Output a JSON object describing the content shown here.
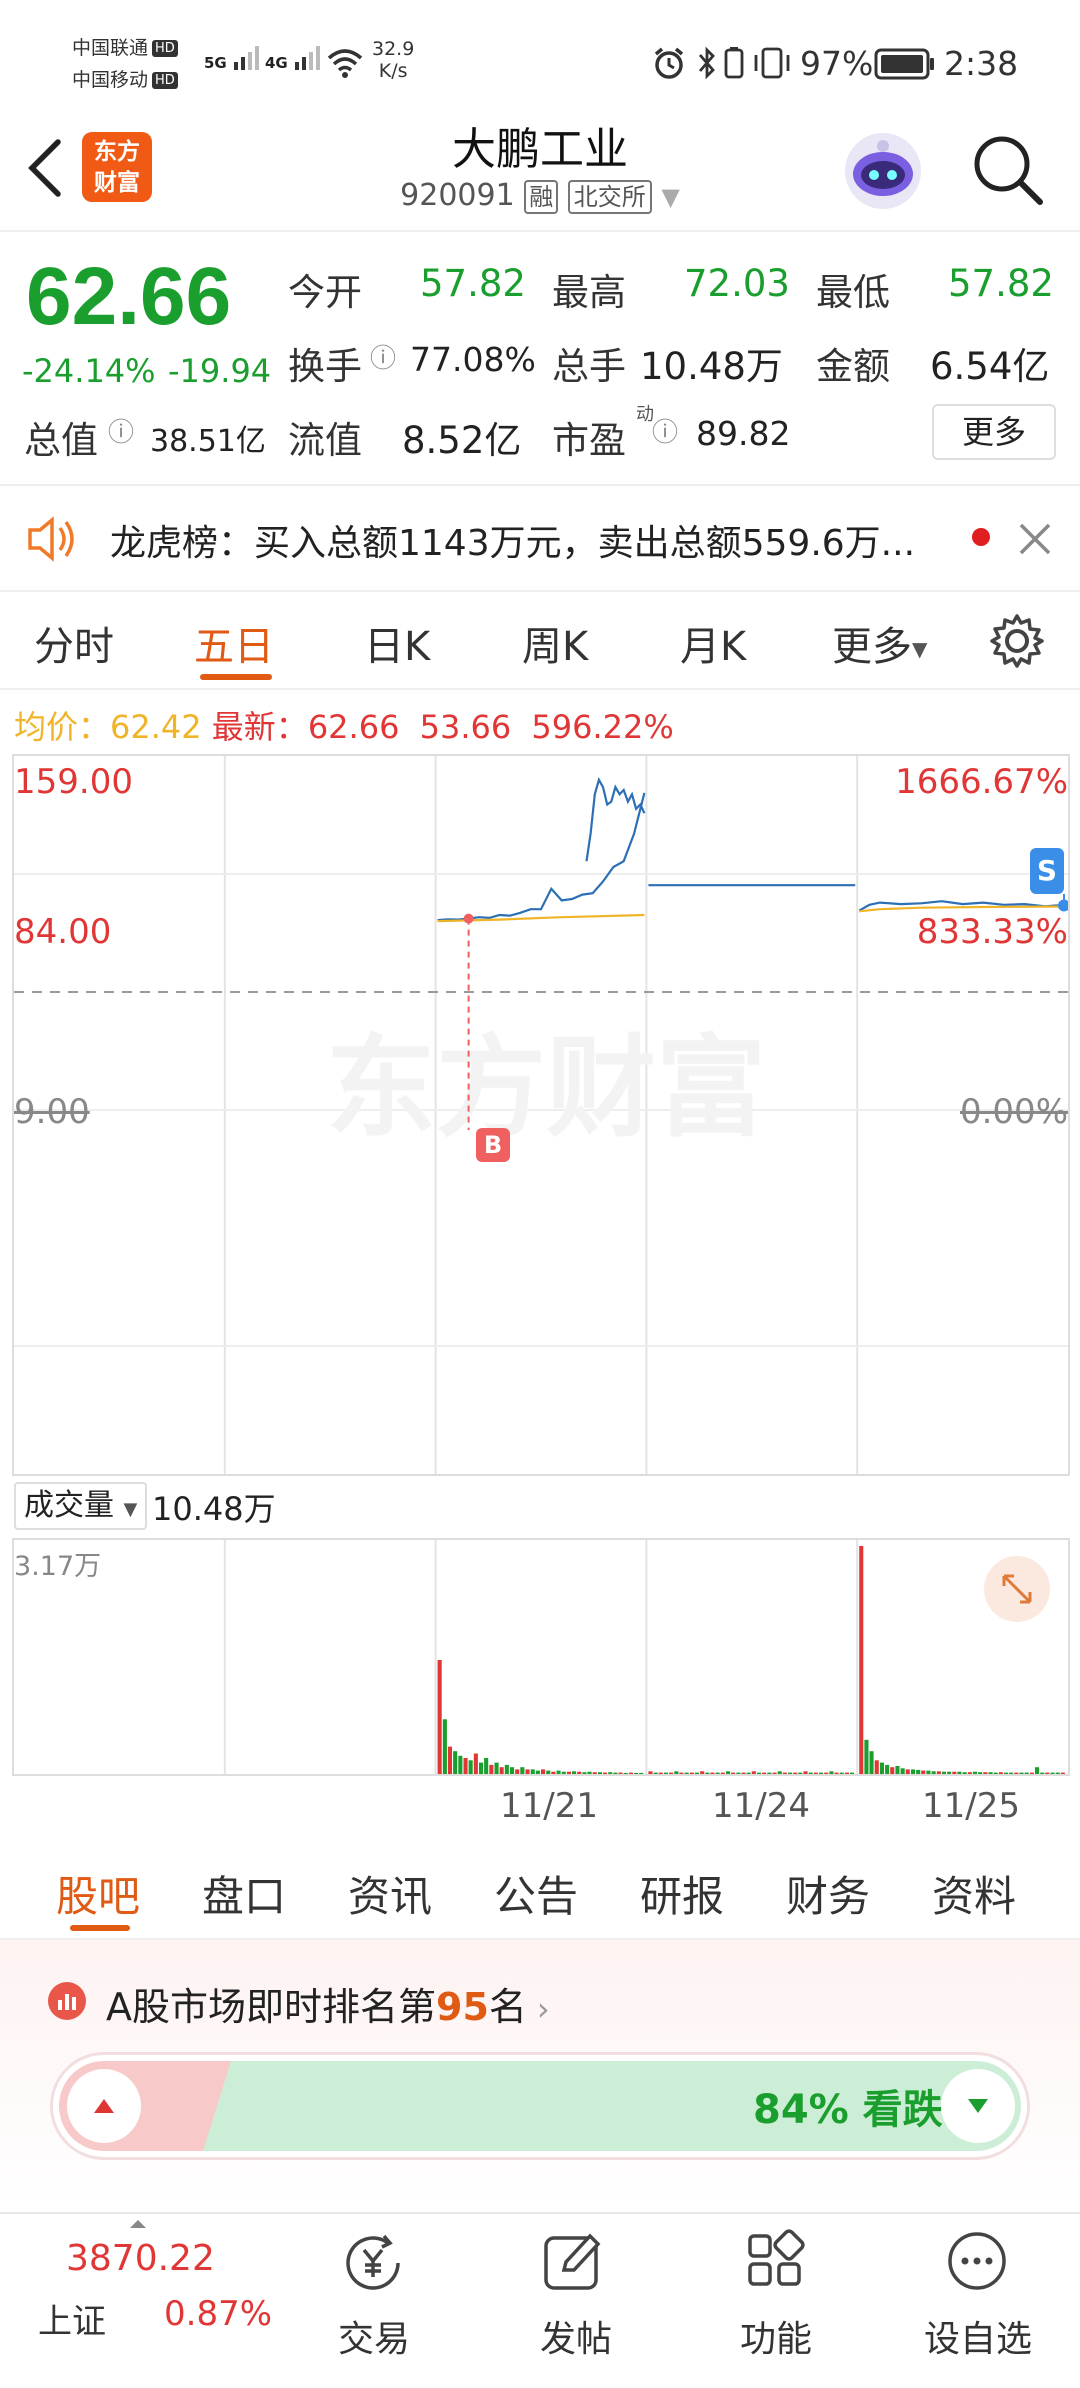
{
  "status_bar": {
    "carrier1": "中国联通",
    "carrier2": "中国移动",
    "hd": "HD",
    "net1": "5G",
    "net2": "4G",
    "speed_value": "32.9",
    "speed_unit": "K/s",
    "battery": "97%",
    "time": "2:38"
  },
  "header": {
    "logo_line1": "东方",
    "logo_line2": "财富",
    "stock_name": "大鹏工业",
    "stock_code": "920091",
    "badge_rong": "融",
    "badge_exchange": "北交所"
  },
  "quote": {
    "price": "62.66",
    "change_pct": "-24.14%",
    "change_amt": "-19.94",
    "open_label": "今开",
    "open": "57.82",
    "high_label": "最高",
    "high": "72.03",
    "low_label": "最低",
    "low": "57.82",
    "turnover_label": "换手",
    "turnover": "77.08%",
    "volume_label": "总手",
    "volume": "10.48万",
    "amount_label": "金额",
    "amount": "6.54亿",
    "mktcap_label": "总值",
    "mktcap": "38.51亿",
    "float_label": "流值",
    "float": "8.52亿",
    "pe_label": "市盈",
    "pe_sup": "动",
    "pe": "89.82",
    "more": "更多"
  },
  "notice": {
    "text": "龙虎榜：买入总额1143万元，卖出总额559.6万..."
  },
  "chart_tabs": [
    "分时",
    "五日",
    "日K",
    "周K",
    "月K",
    "更多"
  ],
  "chart_tab_active": 1,
  "chart_info": {
    "avg_label": "均价：",
    "avg": "62.42",
    "latest_label": "最新：",
    "latest": "62.66",
    "change": "53.66",
    "change_pct": "596.22%"
  },
  "chart_axis": {
    "y_top": "159.00",
    "y_mid": "84.00",
    "y_base": "9.00",
    "pct_top": "1666.67%",
    "pct_mid": "833.33%",
    "pct_base": "0.00%"
  },
  "markers": {
    "buy": "B",
    "sell": "S"
  },
  "watermark": "东方财富",
  "volume": {
    "label": "成交量",
    "total": "10.48万",
    "max": "3.17万"
  },
  "x_labels": [
    "11/21",
    "11/24",
    "11/25"
  ],
  "bottom_tabs": [
    "股吧",
    "盘口",
    "资讯",
    "公告",
    "研报",
    "财务",
    "资料"
  ],
  "bottom_tab_active": 0,
  "rank": {
    "prefix": "A股市场即时排名第",
    "number": "95",
    "suffix": "名"
  },
  "sentiment": {
    "down_text": "84% 看跌"
  },
  "bottom_nav": {
    "index_value": "3870.22",
    "index_name": "上证",
    "index_change": "0.87%",
    "trade": "交易",
    "post": "发帖",
    "functions": "功能",
    "watchlist": "设自选"
  },
  "chart_data": {
    "type": "line",
    "title": "",
    "ylim": [
      9.0,
      159.0
    ],
    "x_labels": [
      "11/21",
      "11/24",
      "11/25"
    ],
    "series": [
      {
        "name": "最新",
        "color": "#2c6fb5",
        "segments": [
          {
            "day": 3,
            "x": [
              0,
              0.05,
              0.1,
              0.15,
              0.2,
              0.25,
              0.3,
              0.35,
              0.4,
              0.45,
              0.5,
              0.55,
              0.6,
              0.65,
              0.7,
              0.75,
              0.8,
              0.85,
              0.9,
              0.95,
              1.0
            ],
            "y": [
              58.5,
              59.0,
              58.8,
              59.5,
              60.5,
              60.0,
              62.0,
              61.5,
              63.5,
              66.0,
              66.0,
              80.0,
              72.0,
              73.0,
              76.0,
              77.0,
              85.0,
              95.0,
              99.0,
              118.0,
              146.0
            ]
          },
          {
            "day": 3,
            "x": [
              0.72,
              0.74,
              0.76,
              0.78,
              0.8,
              0.82,
              0.84,
              0.86,
              0.88,
              0.9,
              0.92,
              0.94,
              0.96,
              0.98,
              1.0
            ],
            "y": [
              99.0,
              118.0,
              145.0,
              155.0,
              150.0,
              138.0,
              140.0,
              150.0,
              145.0,
              148.0,
              140.0,
              145.0,
              135.0,
              138.0,
              132.0
            ]
          },
          {
            "day": 4,
            "x": [
              0,
              1
            ],
            "y": [
              82.5,
              82.5
            ]
          },
          {
            "day": 5,
            "x": [
              0,
              0.05,
              0.1,
              0.2,
              0.3,
              0.4,
              0.5,
              0.6,
              0.7,
              0.8,
              0.9,
              0.95,
              1.0
            ],
            "y": [
              65.0,
              69.0,
              70.5,
              69.5,
              70.0,
              71.5,
              69.5,
              70.5,
              69.0,
              69.5,
              68.0,
              68.5,
              68.5
            ]
          }
        ]
      },
      {
        "name": "均价",
        "color": "#f0b429",
        "segments": [
          {
            "day": 3,
            "x": [
              0,
              0.3,
              0.6,
              1.0
            ],
            "y": [
              57.8,
              58.8,
              60.5,
              62.0
            ]
          },
          {
            "day": 5,
            "x": [
              0,
              0.1,
              0.3,
              0.6,
              1.0
            ],
            "y": [
              64.5,
              66.0,
              67.0,
              67.5,
              67.8
            ]
          }
        ]
      }
    ]
  }
}
